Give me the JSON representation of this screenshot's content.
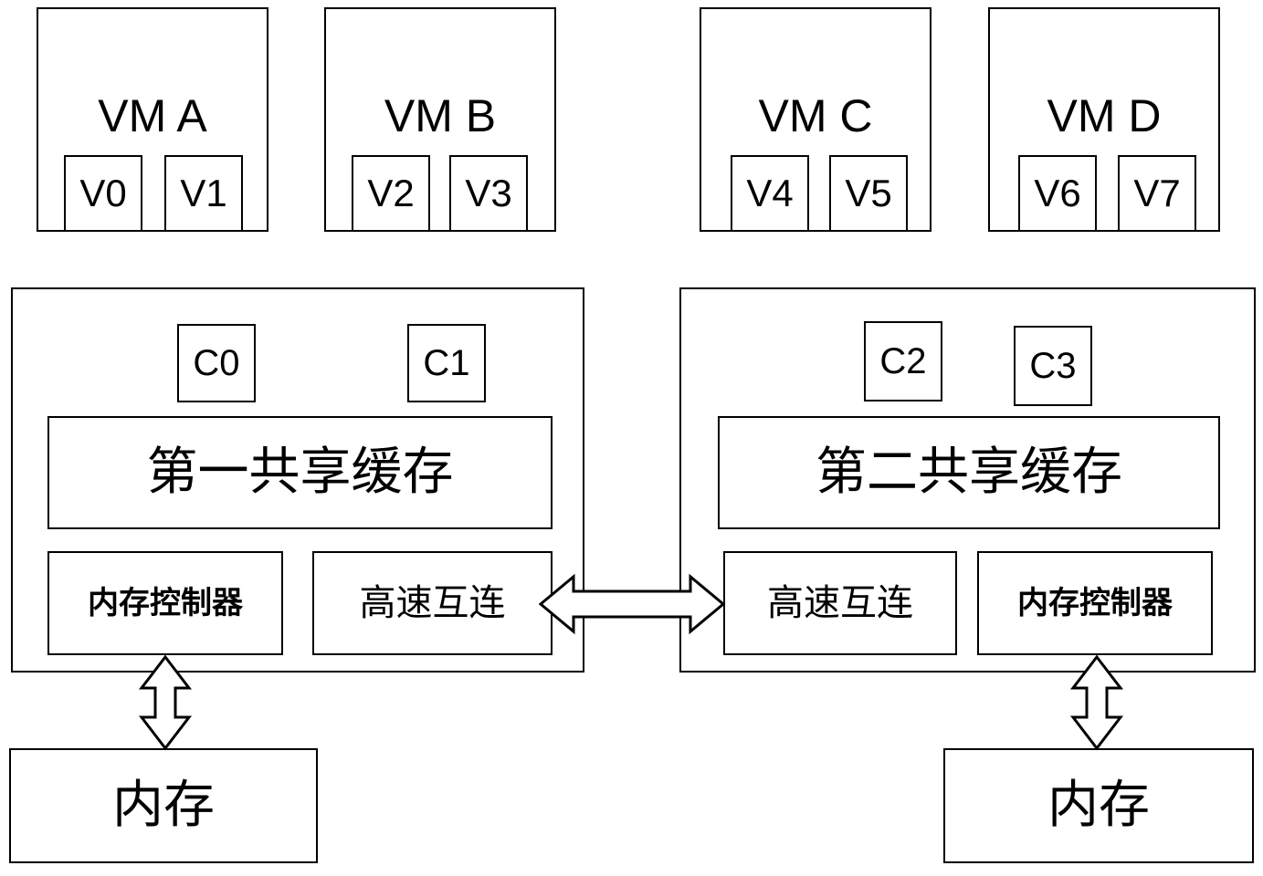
{
  "diagram": {
    "title": "NUMA multi-socket virtualization architecture",
    "stroke_color": "#000000",
    "background_color": "#ffffff"
  },
  "vms": [
    {
      "name": "VM A",
      "vcpus": [
        {
          "label": "V0"
        },
        {
          "label": "V1"
        }
      ]
    },
    {
      "name": "VM B",
      "vcpus": [
        {
          "label": "V2"
        },
        {
          "label": "V3"
        }
      ]
    },
    {
      "name": "VM C",
      "vcpus": [
        {
          "label": "V4"
        },
        {
          "label": "V5"
        }
      ]
    },
    {
      "name": "VM D",
      "vcpus": [
        {
          "label": "V6"
        },
        {
          "label": "V7"
        }
      ]
    }
  ],
  "sockets": [
    {
      "cores": [
        {
          "label": "C0"
        },
        {
          "label": "C1"
        }
      ],
      "shared_cache": "第一共享缓存",
      "memory_controller": "内存控制器",
      "interconnect": "高速互连"
    },
    {
      "cores": [
        {
          "label": "C2"
        },
        {
          "label": "C3"
        }
      ],
      "shared_cache": "第二共享缓存",
      "memory_controller": "内存控制器",
      "interconnect": "高速互连"
    }
  ],
  "memories": [
    {
      "label": "内存"
    },
    {
      "label": "内存"
    }
  ],
  "connectors": {
    "interconnect_link": "双向高速互连箭头",
    "left_memory_link": "双向内存箭头",
    "right_memory_link": "双向内存箭头"
  }
}
